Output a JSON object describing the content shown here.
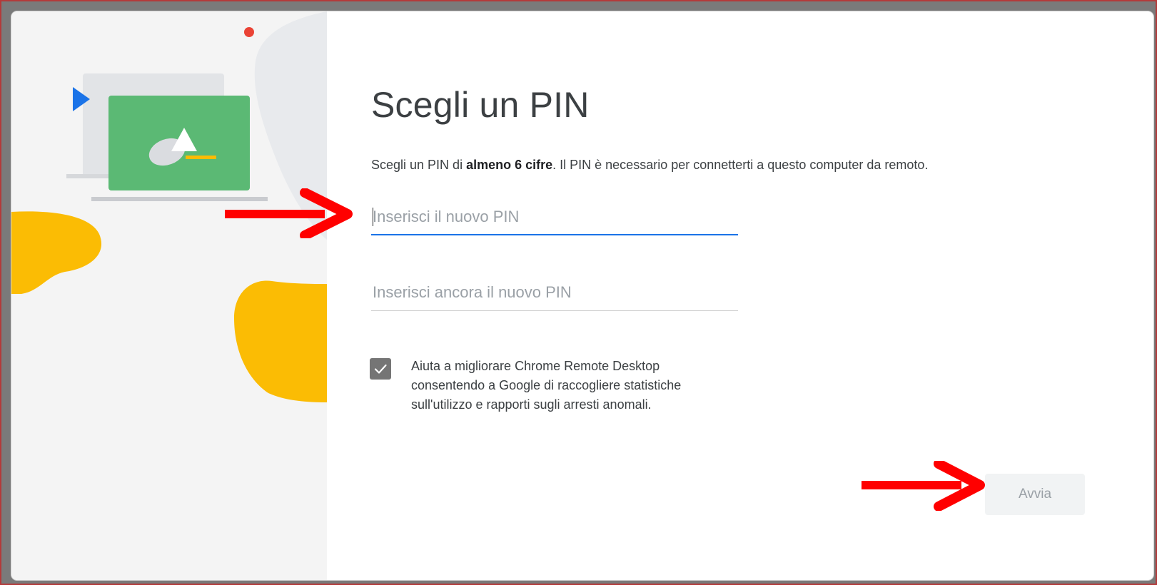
{
  "dialog": {
    "title": "Scegli un PIN",
    "description": {
      "prefix": "Scegli un PIN di ",
      "emphasis": "almeno 6 cifre",
      "suffix": ". Il PIN è necessario per connetterti a questo computer da remoto."
    },
    "pin_input": {
      "value": "",
      "placeholder": "Inserisci il nuovo PIN"
    },
    "pin_confirm_input": {
      "value": "",
      "placeholder": "Inserisci ancora il nuovo PIN"
    },
    "consent_checkbox": {
      "checked": true,
      "label": "Aiuta a migliorare Chrome Remote Desktop consentendo a Google di raccogliere statistiche sull'utilizzo e rapporti sugli arresti anomali."
    },
    "start_button": {
      "label": "Avvia",
      "enabled": false
    }
  },
  "colors": {
    "focus_blue": "#1a73e8",
    "annotation_red": "#ff0000",
    "illustration_green": "#5bb974",
    "illustration_yellow": "#fbbc04",
    "illustration_blue": "#1a73e8",
    "illustration_red": "#ea4335"
  },
  "icons": {
    "checkbox": "check-icon",
    "annotation": "arrow-right-icon"
  }
}
